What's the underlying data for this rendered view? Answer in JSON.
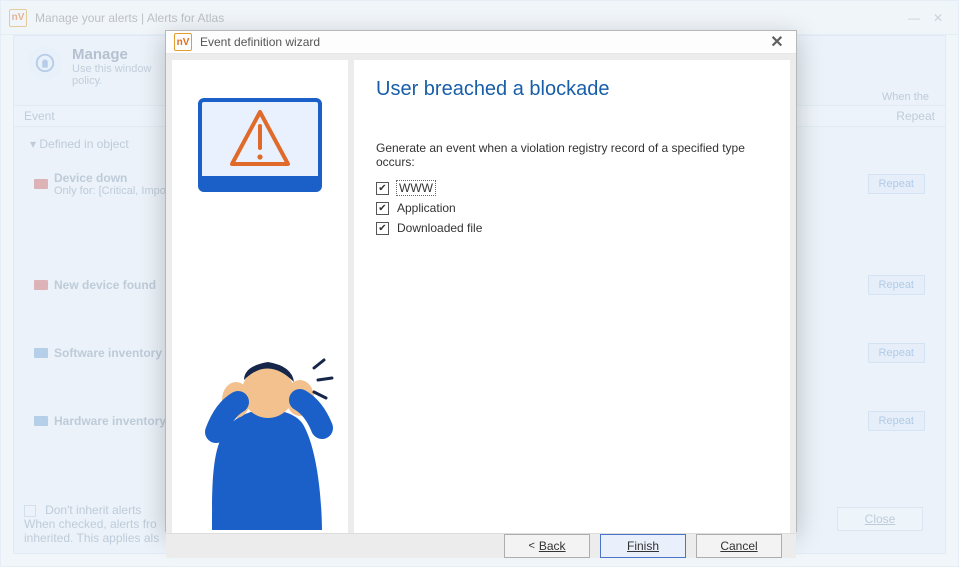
{
  "main": {
    "title": "Manage your alerts | Alerts for Atlas",
    "heading": "Manage",
    "subtitle1": "Use this window",
    "subtitle2": "policy.",
    "whenLabel": "When the",
    "cols": {
      "event": "Event",
      "repeat": "Repeat"
    },
    "group": "Defined in object",
    "rows": [
      {
        "icon": "red",
        "label": "Device down",
        "sub": "Only for: [Critical, Impo",
        "repeat": "Repeat"
      },
      {
        "icon": "red",
        "label": "New device found",
        "sub": "",
        "repeat": "Repeat"
      },
      {
        "icon": "blue",
        "label": "Software inventory cha",
        "sub": "",
        "repeat": "Repeat"
      },
      {
        "icon": "blue",
        "label": "Hardware inventory cha",
        "sub": "",
        "repeat": "Repeat"
      }
    ],
    "inheritChk": "Don't inherit alerts",
    "inheritText1": "When checked, alerts fro",
    "inheritText2": "inherited. This applies als",
    "closeBtn": "Close"
  },
  "wizard": {
    "title": "Event definition wizard",
    "heading": "User breached a blockade",
    "description": "Generate an event when a violation registry record of a specified type occurs:",
    "options": [
      {
        "label": "WWW",
        "checked": true,
        "focused": true
      },
      {
        "label": "Application",
        "checked": true,
        "focused": false
      },
      {
        "label": "Downloaded file",
        "checked": true,
        "focused": false
      }
    ],
    "buttons": {
      "backPrefix": "< ",
      "back": "Back",
      "finish": "Finish",
      "cancel": "Cancel"
    }
  }
}
